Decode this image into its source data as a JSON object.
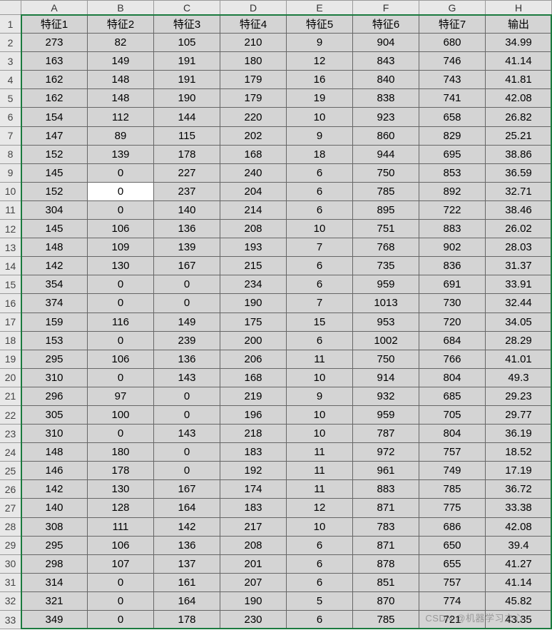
{
  "columns": [
    "A",
    "B",
    "C",
    "D",
    "E",
    "F",
    "G",
    "H"
  ],
  "header_row": [
    "特征1",
    "特征2",
    "特征3",
    "特征4",
    "特征5",
    "特征6",
    "特征7",
    "输出"
  ],
  "rows": [
    [
      "273",
      "82",
      "105",
      "210",
      "9",
      "904",
      "680",
      "34.99"
    ],
    [
      "163",
      "149",
      "191",
      "180",
      "12",
      "843",
      "746",
      "41.14"
    ],
    [
      "162",
      "148",
      "191",
      "179",
      "16",
      "840",
      "743",
      "41.81"
    ],
    [
      "162",
      "148",
      "190",
      "179",
      "19",
      "838",
      "741",
      "42.08"
    ],
    [
      "154",
      "112",
      "144",
      "220",
      "10",
      "923",
      "658",
      "26.82"
    ],
    [
      "147",
      "89",
      "115",
      "202",
      "9",
      "860",
      "829",
      "25.21"
    ],
    [
      "152",
      "139",
      "178",
      "168",
      "18",
      "944",
      "695",
      "38.86"
    ],
    [
      "145",
      "0",
      "227",
      "240",
      "6",
      "750",
      "853",
      "36.59"
    ],
    [
      "152",
      "0",
      "237",
      "204",
      "6",
      "785",
      "892",
      "32.71"
    ],
    [
      "304",
      "0",
      "140",
      "214",
      "6",
      "895",
      "722",
      "38.46"
    ],
    [
      "145",
      "106",
      "136",
      "208",
      "10",
      "751",
      "883",
      "26.02"
    ],
    [
      "148",
      "109",
      "139",
      "193",
      "7",
      "768",
      "902",
      "28.03"
    ],
    [
      "142",
      "130",
      "167",
      "215",
      "6",
      "735",
      "836",
      "31.37"
    ],
    [
      "354",
      "0",
      "0",
      "234",
      "6",
      "959",
      "691",
      "33.91"
    ],
    [
      "374",
      "0",
      "0",
      "190",
      "7",
      "1013",
      "730",
      "32.44"
    ],
    [
      "159",
      "116",
      "149",
      "175",
      "15",
      "953",
      "720",
      "34.05"
    ],
    [
      "153",
      "0",
      "239",
      "200",
      "6",
      "1002",
      "684",
      "28.29"
    ],
    [
      "295",
      "106",
      "136",
      "206",
      "11",
      "750",
      "766",
      "41.01"
    ],
    [
      "310",
      "0",
      "143",
      "168",
      "10",
      "914",
      "804",
      "49.3"
    ],
    [
      "296",
      "97",
      "0",
      "219",
      "9",
      "932",
      "685",
      "29.23"
    ],
    [
      "305",
      "100",
      "0",
      "196",
      "10",
      "959",
      "705",
      "29.77"
    ],
    [
      "310",
      "0",
      "143",
      "218",
      "10",
      "787",
      "804",
      "36.19"
    ],
    [
      "148",
      "180",
      "0",
      "183",
      "11",
      "972",
      "757",
      "18.52"
    ],
    [
      "146",
      "178",
      "0",
      "192",
      "11",
      "961",
      "749",
      "17.19"
    ],
    [
      "142",
      "130",
      "167",
      "174",
      "11",
      "883",
      "785",
      "36.72"
    ],
    [
      "140",
      "128",
      "164",
      "183",
      "12",
      "871",
      "775",
      "33.38"
    ],
    [
      "308",
      "111",
      "142",
      "217",
      "10",
      "783",
      "686",
      "42.08"
    ],
    [
      "295",
      "106",
      "136",
      "208",
      "6",
      "871",
      "650",
      "39.4"
    ],
    [
      "298",
      "107",
      "137",
      "201",
      "6",
      "878",
      "655",
      "41.27"
    ],
    [
      "314",
      "0",
      "161",
      "207",
      "6",
      "851",
      "757",
      "41.14"
    ],
    [
      "321",
      "0",
      "164",
      "190",
      "5",
      "870",
      "774",
      "45.82"
    ],
    [
      "349",
      "0",
      "178",
      "230",
      "6",
      "785",
      "721",
      "43.35"
    ]
  ],
  "active_cell": {
    "row": 10,
    "col": "B"
  },
  "watermark": "CSDN @机器学习之心"
}
